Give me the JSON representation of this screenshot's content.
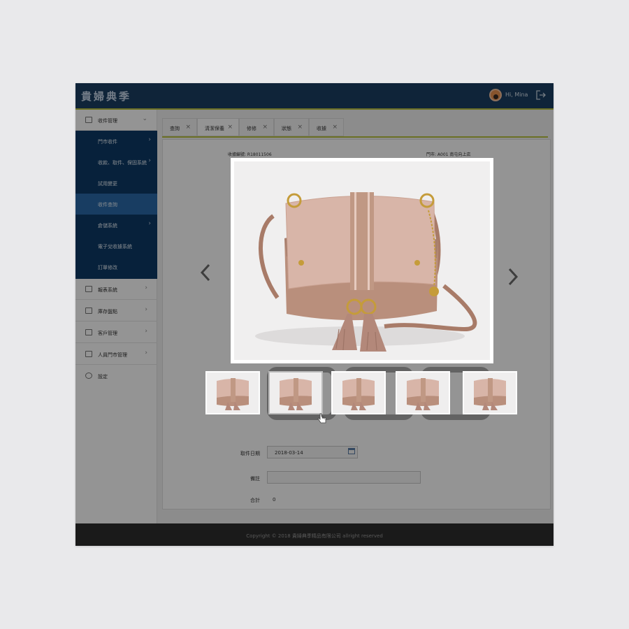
{
  "header": {
    "logo_text": "貴婦典季",
    "greeting": "Hi, Mina"
  },
  "sidebar": {
    "items": [
      {
        "label": "收件管理",
        "expanded": true
      },
      {
        "label": "報表系統"
      },
      {
        "label": "庫存盤點"
      },
      {
        "label": "客戶管理"
      },
      {
        "label": "人員門市管理"
      },
      {
        "label": "設定"
      }
    ],
    "sub_items": [
      {
        "label": "門市收件"
      },
      {
        "label": "收款、取件、保固系統"
      },
      {
        "label": "試用變更"
      },
      {
        "label": "收件查詢",
        "active": true
      },
      {
        "label": "倉儲系統"
      },
      {
        "label": "電子兌收據系統"
      },
      {
        "label": "訂單修改"
      }
    ]
  },
  "tabs": [
    {
      "label": "查詢"
    },
    {
      "label": "清潔保養",
      "active": true
    },
    {
      "label": "修修"
    },
    {
      "label": "狀態"
    },
    {
      "label": "收據"
    }
  ],
  "info": {
    "receipt_no": "收據編號: R18011506",
    "store": "門市: A001 南屯向上店"
  },
  "form": {
    "pickup_date_label": "取件日期",
    "pickup_date_value": "2018-03-14",
    "note_label": "備註",
    "total_label": "合計",
    "total_value": "0"
  },
  "viewer": {
    "image": "handbag-photo",
    "thumbnails": 5,
    "active_thumbnail": 2
  },
  "footer": {
    "copyright": "Copyright ©  2018  貴婦典季精品有限公司  allright reserved"
  }
}
